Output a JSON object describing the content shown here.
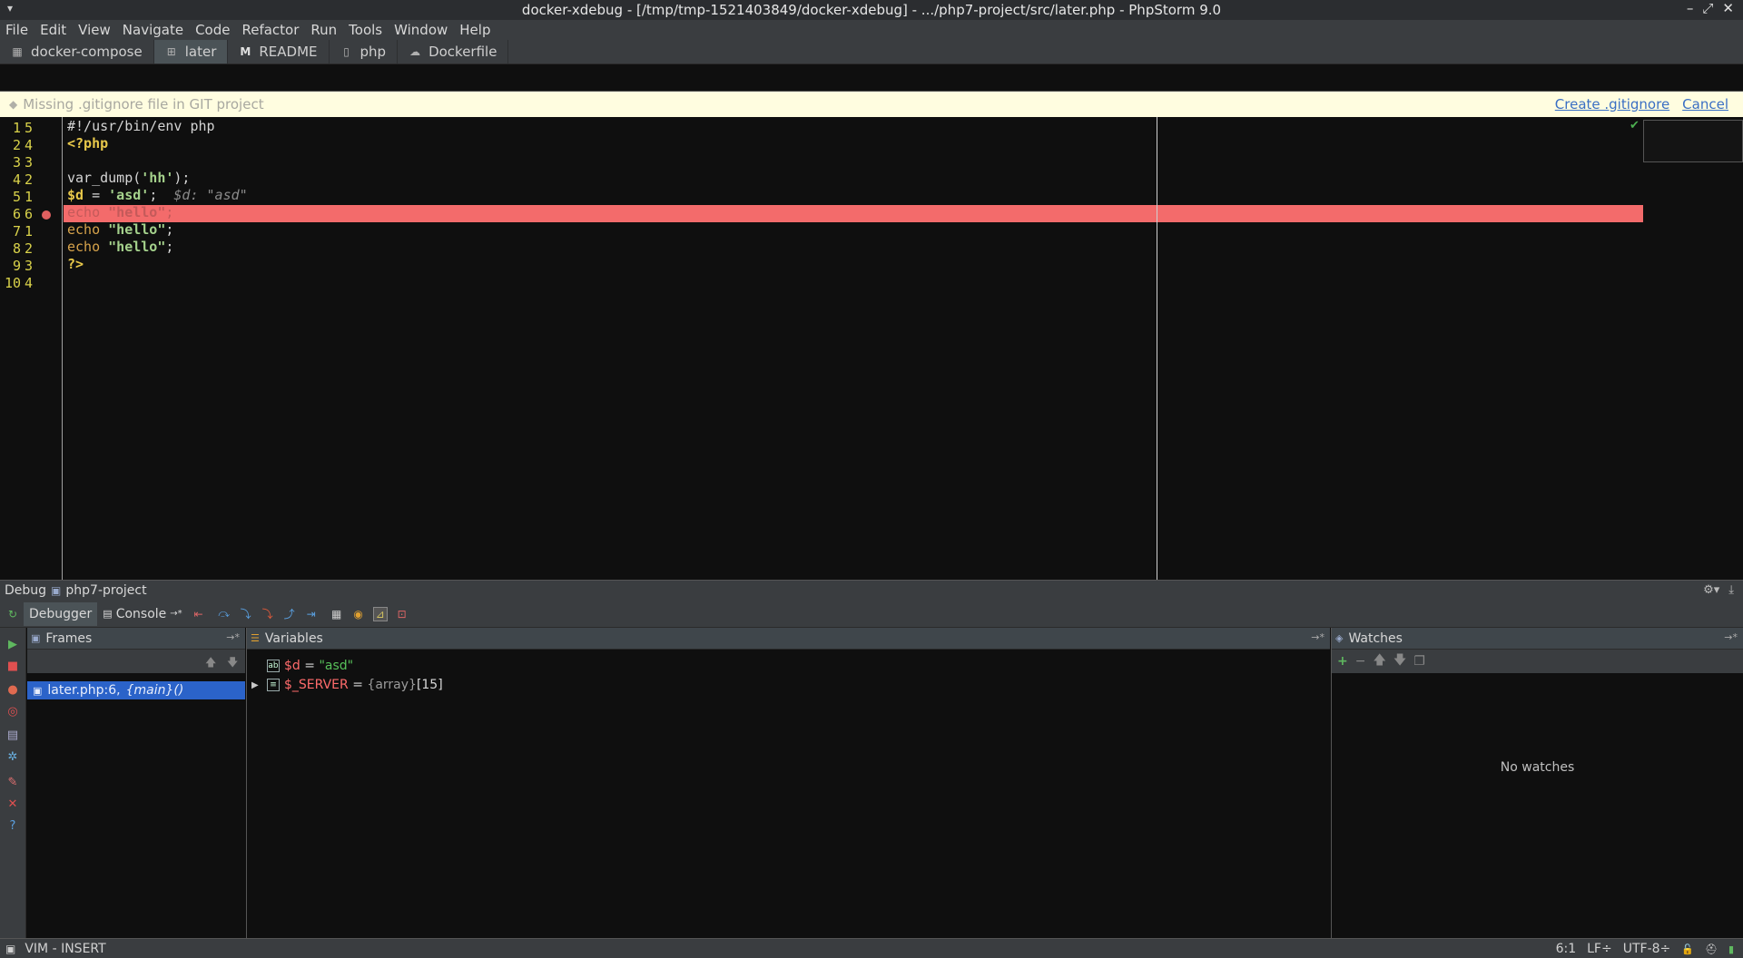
{
  "window": {
    "title": "docker-xdebug - [/tmp/tmp-1521403849/docker-xdebug] - .../php7-project/src/later.php - PhpStorm 9.0",
    "controls": [
      "–",
      "⤢",
      "✕"
    ]
  },
  "menu": [
    "File",
    "Edit",
    "View",
    "Navigate",
    "Code",
    "Refactor",
    "Run",
    "Tools",
    "Window",
    "Help"
  ],
  "tabs": [
    {
      "label": "docker-compose",
      "icon": "table-icon",
      "active": false
    },
    {
      "label": "later",
      "icon": "php-file-icon",
      "active": true
    },
    {
      "label": "README",
      "icon": "markdown-icon",
      "active": false
    },
    {
      "label": "php",
      "icon": "file-icon",
      "active": false
    },
    {
      "label": "Dockerfile",
      "icon": "docker-icon",
      "active": false
    }
  ],
  "notification": {
    "message": "Missing .gitignore file in GIT project",
    "create": "Create .gitignore",
    "cancel": "Cancel"
  },
  "editor": {
    "lines": [
      {
        "num": "1",
        "rel": "5"
      },
      {
        "num": "2",
        "rel": "4"
      },
      {
        "num": "3",
        "rel": "3"
      },
      {
        "num": "4",
        "rel": "2"
      },
      {
        "num": "5",
        "rel": "1"
      },
      {
        "num": "6",
        "rel": "6"
      },
      {
        "num": "7",
        "rel": "1"
      },
      {
        "num": "8",
        "rel": "2"
      },
      {
        "num": "9",
        "rel": "3"
      },
      {
        "num": "10",
        "rel": "4"
      }
    ],
    "code": {
      "l1": "#!/usr/bin/env php",
      "l2": "<?php",
      "l4_fn": "var_dump(",
      "l4_str": "'hh'",
      "l4_end": ");",
      "l5_var": "$d",
      "l5_eq": " = ",
      "l5_str": "'asd'",
      "l5_end": ";",
      "l5_hint": "$d: \"asd\"",
      "echo": "echo",
      "hello": "\"hello\"",
      "semi": ";",
      "l9": "?>"
    }
  },
  "debug": {
    "title": "Debug",
    "config": "php7-project",
    "tabs": {
      "debugger": "Debugger",
      "console": "Console"
    },
    "frames": {
      "title": "Frames",
      "selected_file": "later.php:6,",
      "selected_fn": "{main}()"
    },
    "variables": {
      "title": "Variables",
      "rows": [
        {
          "name": "$d",
          "eq": " = ",
          "value": "\"asd\"",
          "type": ""
        },
        {
          "name": "$_SERVER",
          "eq": " = ",
          "type": "{array}",
          "value": "[15]"
        }
      ]
    },
    "watches": {
      "title": "Watches",
      "empty": "No watches"
    }
  },
  "status": {
    "mode": "VIM - INSERT",
    "position": "6:1",
    "line_sep": "LF÷",
    "encoding": "UTF-8÷"
  },
  "colors": {
    "exec_line": "#f36b6b",
    "frame_selected": "#2b63c9",
    "notification_bg": "#fffde0"
  }
}
